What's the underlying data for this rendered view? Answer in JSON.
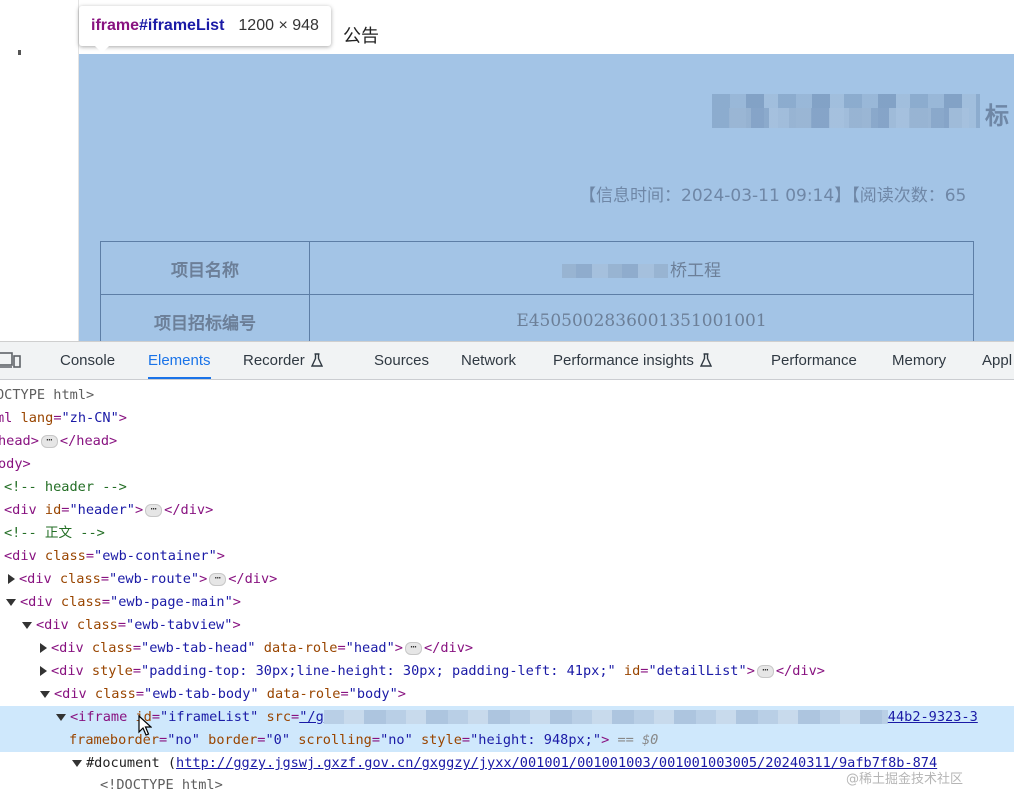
{
  "page": {
    "notice_tail": "公告",
    "title_tail": "标",
    "meta": "【信息时间：2024-03-11 09:14】【阅读次数：65",
    "table_rows": [
      {
        "key": "项目名称",
        "value": "桥工程"
      },
      {
        "key": "项目招标编号",
        "value": "E4505002836001351001001"
      }
    ]
  },
  "tooltip": {
    "tag": "iframe",
    "id": "#iframeList",
    "size": "1200 × 948"
  },
  "devtools": {
    "tabs": [
      {
        "label": "Console",
        "active": false
      },
      {
        "label": "Elements",
        "active": true
      },
      {
        "label": "Recorder",
        "active": false
      },
      {
        "label": "Sources",
        "active": false
      },
      {
        "label": "Network",
        "active": false
      },
      {
        "label": "Performance insights",
        "active": false
      },
      {
        "label": "Performance",
        "active": false
      },
      {
        "label": "Memory",
        "active": false
      },
      {
        "label": "Appl",
        "active": false
      }
    ],
    "tree": {
      "doctype": "OCTYPE html>",
      "html_open": "ml ",
      "html_lang_attr": "lang",
      "html_lang_val": "\"zh-CN\"",
      "head_open": "head>",
      "head_close": "</head>",
      "body_open": "ody>",
      "comment_header": "<!-- header -->",
      "div_header_tag": "<div ",
      "div_header_attr": "id",
      "div_header_val": "\"header\"",
      "div_close": "</div>",
      "comment_main": "<!-- 正文 -->",
      "container_attr_val": "\"ewb-container\"",
      "route_val": "\"ewb-route\"",
      "pagemain_val": "\"ewb-page-main\"",
      "tabview_val": "\"ewb-tabview\"",
      "tabhead_val": "\"ewb-tab-head\"",
      "datarole_head_val": "\"head\"",
      "style_val": "\"padding-top: 30px;line-height: 30px; padding-left: 41px;\"",
      "detaillist_val": "\"detailList\"",
      "tabbody_val": "\"ewb-tab-body\"",
      "datarole_body_val": "\"body\"",
      "iframe_id_val": "\"iframeList\"",
      "iframe_src_start": "\"/g",
      "iframe_src_end": "44b2-9323-3",
      "frameborder_val": "\"no\"",
      "border_val": "\"0\"",
      "scrolling_val": "\"no\"",
      "iframe_style_val": "\"height: 948px;\"",
      "selected_marker": "== $0",
      "document_label": "#document",
      "document_url": "http://ggzy.jgswj.gxzf.gov.cn/gxggzy/jyxx/001001/001001003/001001003005/20240311/9afb7f8b-874",
      "inner_doctype": "<!DOCTYPE html>"
    }
  },
  "watermark": "@稀土掘金技术社区"
}
